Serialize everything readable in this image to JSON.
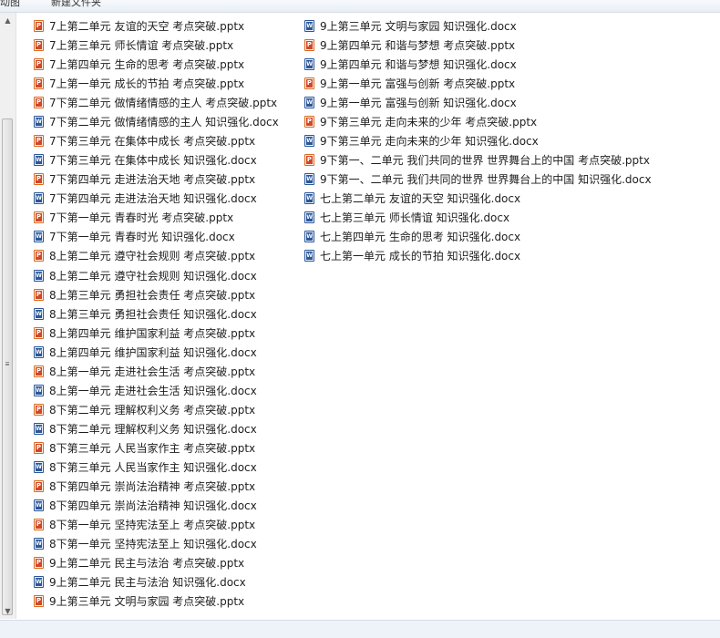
{
  "top_bar": {
    "left_label": "动图",
    "right_label": "新建文件夹"
  },
  "files_col1": [
    {
      "name": "7上第二单元  友谊的天空 考点突破.pptx",
      "type": "pptx"
    },
    {
      "name": "7上第三单元  师长情谊 考点突破.pptx",
      "type": "pptx"
    },
    {
      "name": "7上第四单元  生命的思考 考点突破.pptx",
      "type": "pptx"
    },
    {
      "name": "7上第一单元  成长的节拍 考点突破.pptx",
      "type": "pptx"
    },
    {
      "name": "7下第二单元  做情绪情感的主人 考点突破.pptx",
      "type": "pptx"
    },
    {
      "name": "7下第二单元  做情绪情感的主人 知识强化.docx",
      "type": "docx"
    },
    {
      "name": "7下第三单元  在集体中成长 考点突破.pptx",
      "type": "pptx"
    },
    {
      "name": "7下第三单元  在集体中成长 知识强化.docx",
      "type": "docx"
    },
    {
      "name": "7下第四单元  走进法治天地 考点突破.pptx",
      "type": "pptx"
    },
    {
      "name": "7下第四单元  走进法治天地 知识强化.docx",
      "type": "docx"
    },
    {
      "name": "7下第一单元  青春时光 考点突破.pptx",
      "type": "pptx"
    },
    {
      "name": "7下第一单元  青春时光 知识强化.docx",
      "type": "docx"
    },
    {
      "name": "8上第二单元  遵守社会规则 考点突破.pptx",
      "type": "pptx"
    },
    {
      "name": "8上第二单元  遵守社会规则 知识强化.docx",
      "type": "docx"
    },
    {
      "name": "8上第三单元  勇担社会责任 考点突破.pptx",
      "type": "pptx"
    },
    {
      "name": "8上第三单元  勇担社会责任 知识强化.docx",
      "type": "docx"
    },
    {
      "name": "8上第四单元  维护国家利益 考点突破.pptx",
      "type": "pptx"
    },
    {
      "name": "8上第四单元  维护国家利益 知识强化.docx",
      "type": "docx"
    },
    {
      "name": "8上第一单元  走进社会生活 考点突破.pptx",
      "type": "pptx"
    },
    {
      "name": "8上第一单元  走进社会生活 知识强化.docx",
      "type": "docx"
    },
    {
      "name": "8下第二单元  理解权利义务 考点突破.pptx",
      "type": "pptx"
    },
    {
      "name": "8下第二单元  理解权利义务 知识强化.docx",
      "type": "docx"
    },
    {
      "name": "8下第三单元  人民当家作主 考点突破.pptx",
      "type": "pptx"
    },
    {
      "name": "8下第三单元  人民当家作主 知识强化.docx",
      "type": "docx"
    },
    {
      "name": "8下第四单元  崇尚法治精神 考点突破.pptx",
      "type": "pptx"
    },
    {
      "name": "8下第四单元  崇尚法治精神 知识强化.docx",
      "type": "docx"
    },
    {
      "name": "8下第一单元  坚持宪法至上 考点突破.pptx",
      "type": "pptx"
    },
    {
      "name": "8下第一单元  坚持宪法至上 知识强化.docx",
      "type": "docx"
    },
    {
      "name": "9上第二单元  民主与法治 考点突破.pptx",
      "type": "pptx"
    },
    {
      "name": "9上第二单元  民主与法治 知识强化.docx",
      "type": "docx"
    },
    {
      "name": "9上第三单元  文明与家园 考点突破.pptx",
      "type": "pptx"
    }
  ],
  "files_col2": [
    {
      "name": "9上第三单元  文明与家园 知识强化.docx",
      "type": "docx"
    },
    {
      "name": "9上第四单元  和谐与梦想 考点突破.pptx",
      "type": "pptx"
    },
    {
      "name": "9上第四单元  和谐与梦想 知识强化.docx",
      "type": "docx"
    },
    {
      "name": "9上第一单元  富强与创新 考点突破.pptx",
      "type": "pptx"
    },
    {
      "name": "9上第一单元  富强与创新 知识强化.docx",
      "type": "docx"
    },
    {
      "name": "9下第三单元  走向未来的少年 考点突破.pptx",
      "type": "pptx"
    },
    {
      "name": "9下第三单元  走向未来的少年 知识强化.docx",
      "type": "docx"
    },
    {
      "name": "9下第一、二单元  我们共同的世界  世界舞台上的中国 考点突破.pptx",
      "type": "pptx"
    },
    {
      "name": "9下第一、二单元  我们共同的世界  世界舞台上的中国 知识强化.docx",
      "type": "docx"
    },
    {
      "name": "七上第二单元  友谊的天空 知识强化.docx",
      "type": "docx"
    },
    {
      "name": "七上第三单元  师长情谊 知识强化.docx",
      "type": "docx"
    },
    {
      "name": "七上第四单元  生命的思考 知识强化.docx",
      "type": "docx"
    },
    {
      "name": "七上第一单元  成长的节拍 知识强化.docx",
      "type": "docx"
    }
  ]
}
